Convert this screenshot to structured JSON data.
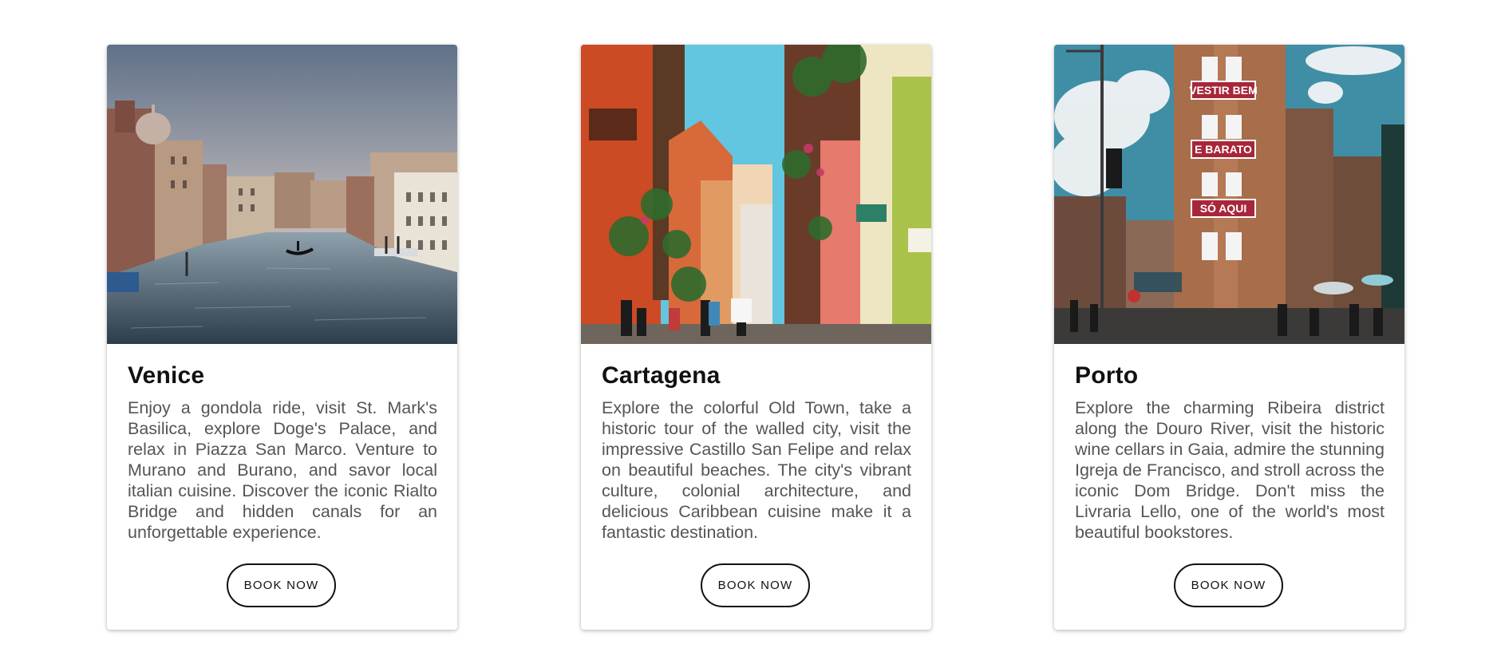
{
  "cards": [
    {
      "title": "Venice",
      "description": "Enjoy a gondola ride, visit St. Mark's Basilica, explore Doge's Palace, and relax in Piazza San Marco. Venture to Murano and Burano, and savor local italian cuisine. Discover the iconic Rialto Bridge and hidden canals for an unforgettable experience.",
      "button_label": "BOOK NOW"
    },
    {
      "title": "Cartagena",
      "description": "Explore the colorful Old Town, take a historic tour of the walled city, visit the impressive Castillo San Felipe and relax on beautiful beaches. The city's vibrant culture, colonial architecture, and delicious Caribbean cuisine make it a fantastic destination.",
      "button_label": "BOOK NOW"
    },
    {
      "title": "Porto",
      "description": "Explore the charming Ribeira district along the Douro River, visit the historic wine cellars in Gaia, admire the stunning Igreja de Francisco, and stroll across the iconic Dom Bridge. Don't miss the Livraria Lello, one of the world's most beautiful bookstores.",
      "button_label": "BOOK NOW"
    }
  ],
  "photo_signs": {
    "porto": [
      "VESTIR BEM",
      "E BARATO",
      "SÓ AQUI"
    ]
  },
  "colors": {
    "title": "#111111",
    "description": "#555555",
    "button_border": "#111111"
  }
}
